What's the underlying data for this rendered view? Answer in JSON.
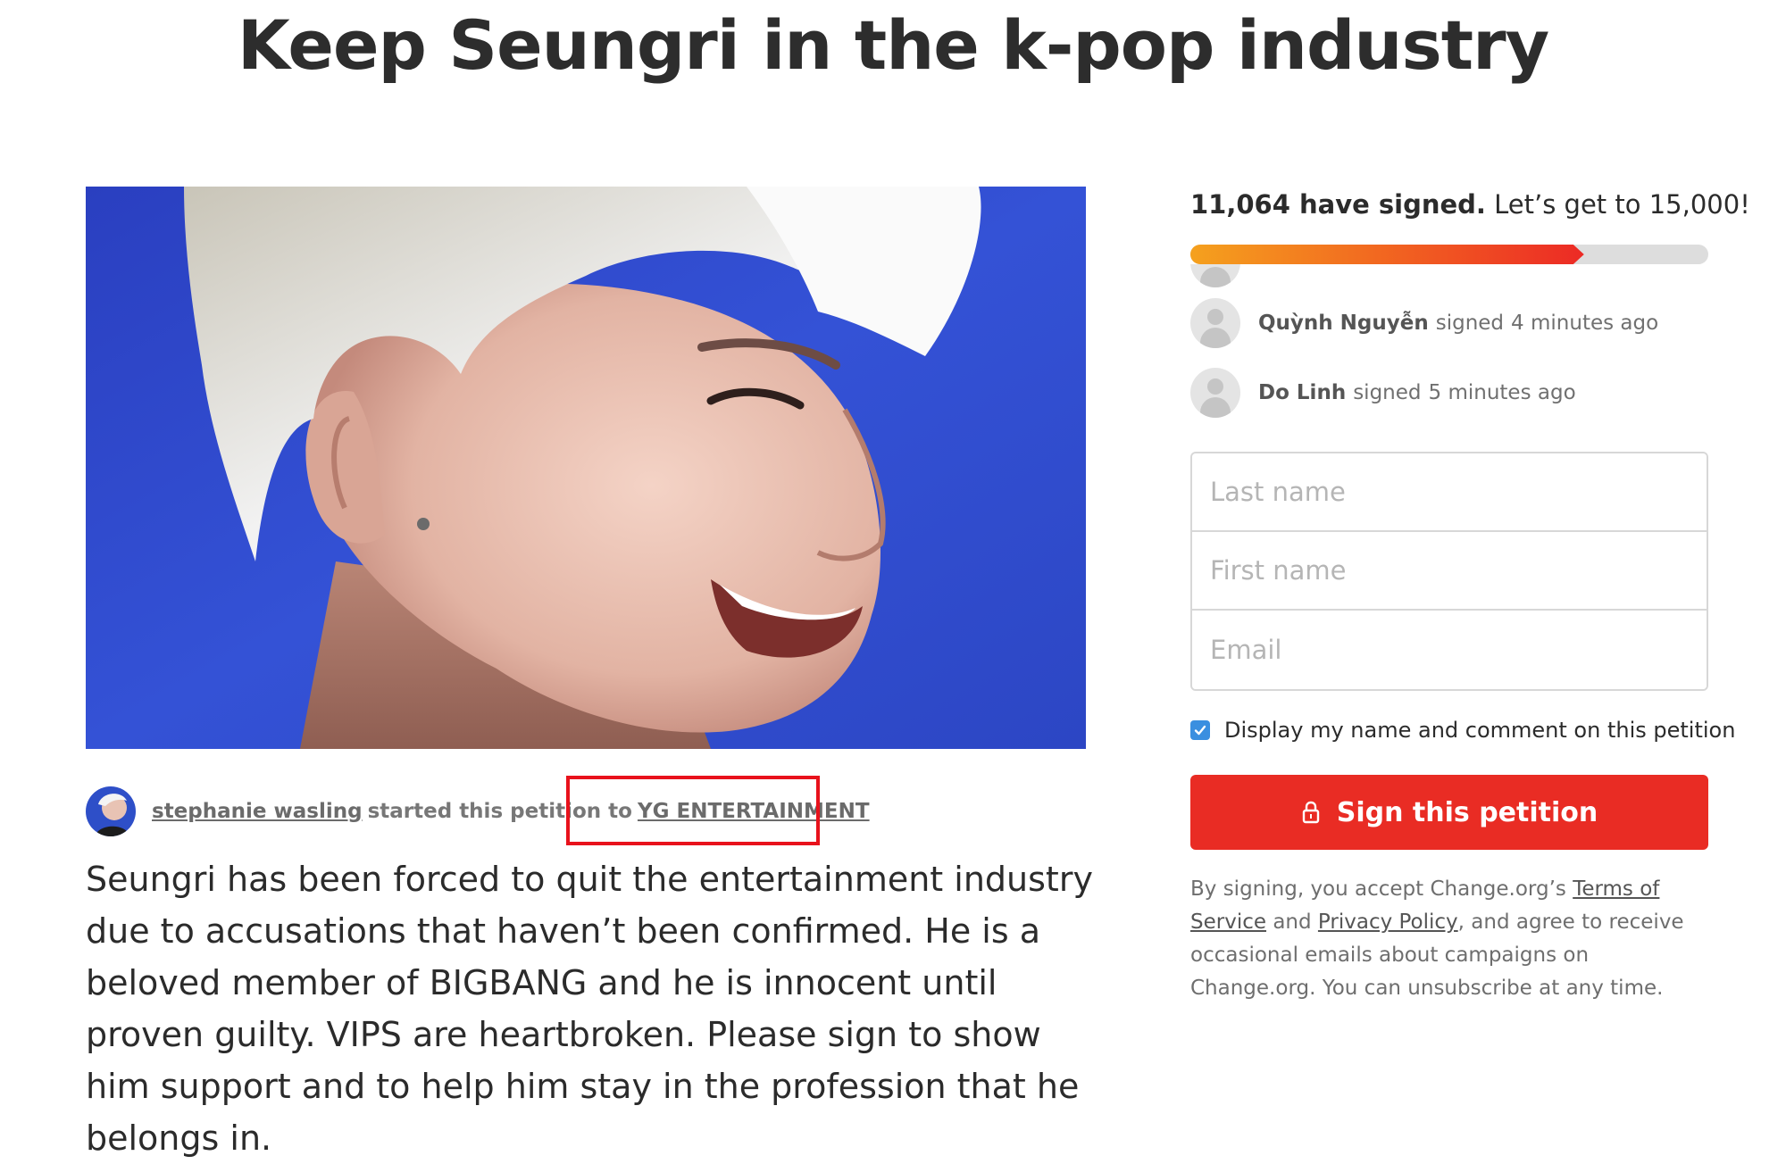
{
  "page": {
    "title": "Keep Seungri in the k-pop industry"
  },
  "petition": {
    "starter_name": "stephanie wasling",
    "started_text": "started this petition to",
    "target": "YG ENTERTAINMENT",
    "description": "Seungri has been forced to quit the entertainment industry due to accusations that haven’t been confirmed. He is a beloved member of BIGBANG and he is innocent until proven guilty. VIPS are heartbroken. Please sign to show him support and to help him stay in the profession that he belongs in."
  },
  "signatures": {
    "count_text": "11,064 have signed.",
    "goal_text": "Let’s get to 15,000!",
    "signed": 11064,
    "goal": 15000,
    "progress_fraction": 0.76
  },
  "recent_signers": [
    {
      "name": "Quỳnh Nguyễn",
      "action": "signed",
      "time": "4 minutes ago"
    },
    {
      "name": "Do Linh",
      "action": "signed",
      "time": "5 minutes ago"
    }
  ],
  "form": {
    "last_name_placeholder": "Last name",
    "first_name_placeholder": "First name",
    "email_placeholder": "Email",
    "display_checkbox_label": "Display my name and comment on this petition",
    "display_checked": true,
    "sign_button_label": "Sign this petition"
  },
  "legal": {
    "prefix": "By signing, you accept Change.org’s",
    "terms_link": "Terms of Service",
    "and": "and",
    "privacy_link": "Privacy Policy",
    "suffix": ", and agree to receive occasional emails about campaigns on Change.org. You can unsubscribe at any time."
  },
  "colors": {
    "accent_red": "#e92c24",
    "highlight_box": "#e8121c",
    "checkbox_blue": "#3a8fe0",
    "progress_start": "#f5a11e",
    "progress_end": "#ec2a25"
  },
  "icons": {
    "lock": "lock-icon",
    "checkbox": "checkmark-icon"
  }
}
